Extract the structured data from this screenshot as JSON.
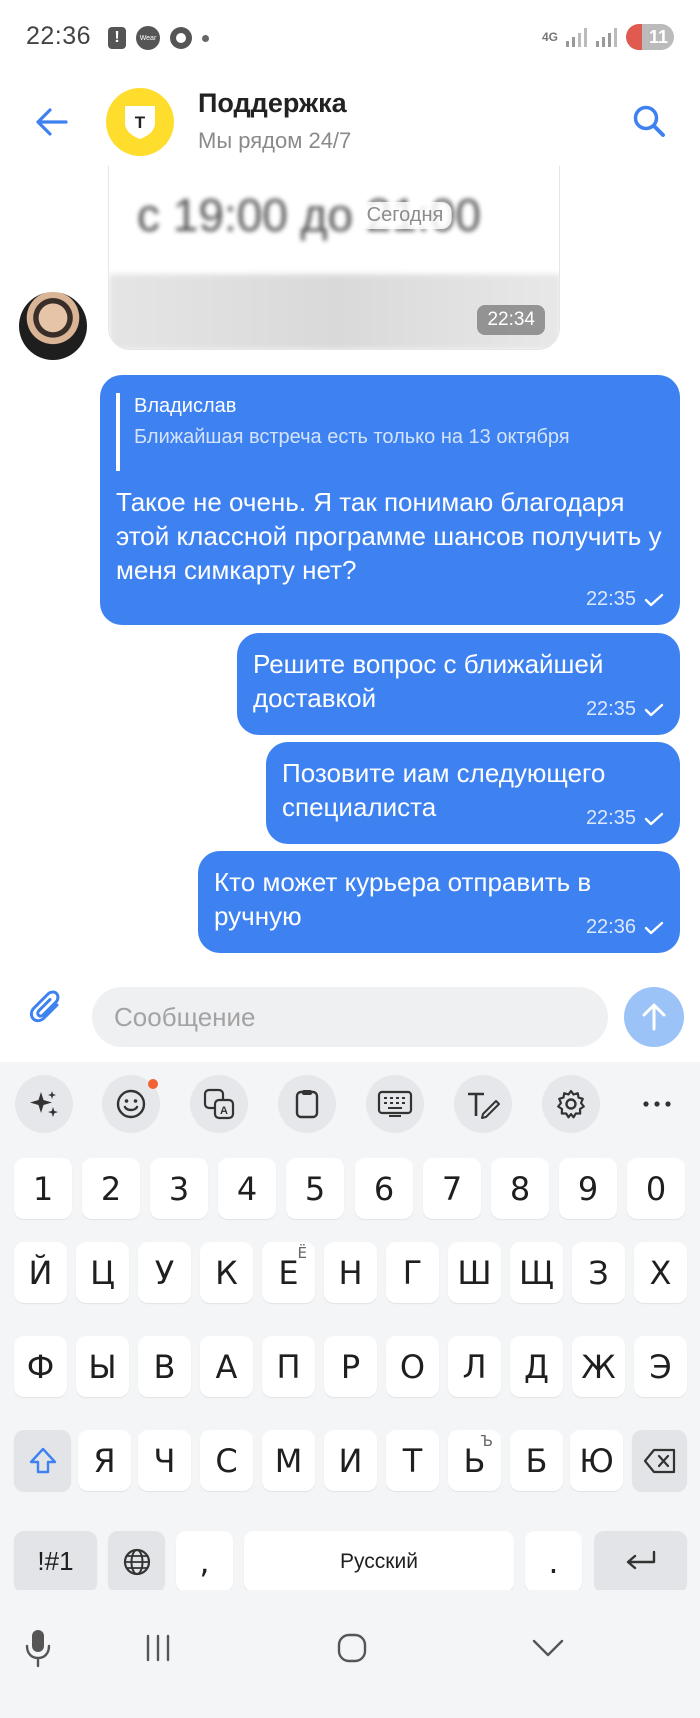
{
  "status_bar": {
    "time": "22:36",
    "wear_label": "Wear",
    "network": "4G",
    "battery": "11"
  },
  "header": {
    "title": "Поддержка",
    "subtitle": "Мы рядом 24/7",
    "logo_letter": "Т"
  },
  "chat": {
    "incoming_card": {
      "blurred_text": "с 19:00 до 21:00",
      "date_label": "Сегодня",
      "time": "22:34"
    },
    "messages": [
      {
        "reply_name": "Владислав",
        "reply_text": "Ближайшая встреча есть только на 13 октября",
        "text": "Такое не очень. Я так понимаю благодаря этой классной программе шансов получить у меня симкарту нет?",
        "time": "22:35"
      },
      {
        "text": "Решите вопрос с ближайшей доставкой",
        "time": "22:35"
      },
      {
        "text": "Позовите иам следующего специалиста",
        "time": "22:35"
      },
      {
        "text": "Кто может курьера отправить в ручную",
        "time": "22:36"
      }
    ]
  },
  "composer": {
    "placeholder": "Сообщение"
  },
  "keyboard": {
    "row_numbers": [
      "1",
      "2",
      "3",
      "4",
      "5",
      "6",
      "7",
      "8",
      "9",
      "0"
    ],
    "row1": [
      "Й",
      "Ц",
      "У",
      "К",
      "Е",
      "Н",
      "Г",
      "Ш",
      "Щ",
      "З",
      "Х"
    ],
    "row1_sub": {
      "4": "Ё"
    },
    "row2": [
      "Ф",
      "Ы",
      "В",
      "А",
      "П",
      "Р",
      "О",
      "Л",
      "Д",
      "Ж",
      "Э"
    ],
    "row3": [
      "Я",
      "Ч",
      "С",
      "М",
      "И",
      "Т",
      "Ь",
      "Б",
      "Ю"
    ],
    "row3_sub": {
      "6": "Ъ"
    },
    "symbols_label": "!#1",
    "comma": ",",
    "space_label": "Русский",
    "period": "."
  },
  "colors": {
    "accent": "#3e82f1",
    "logo_yellow": "#ffdd2d",
    "send_disabled": "#9cc3f7",
    "badge": "#f06232"
  }
}
